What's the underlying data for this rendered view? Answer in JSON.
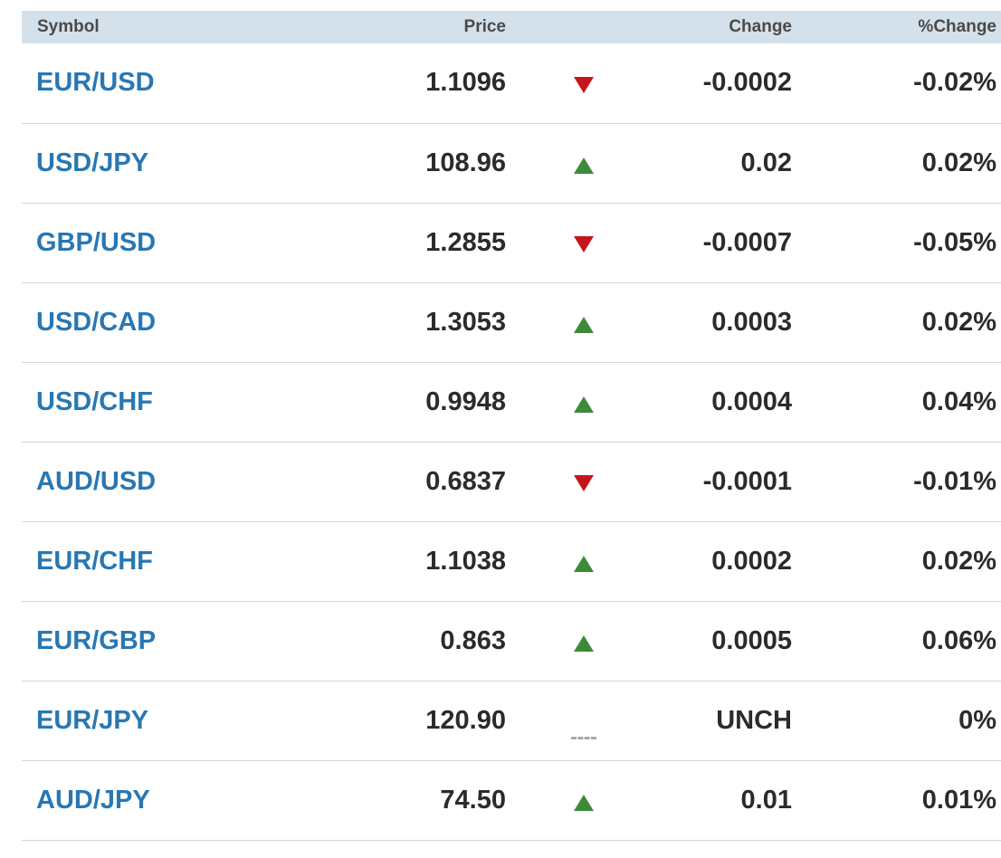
{
  "header": {
    "symbol": "Symbol",
    "price": "Price",
    "change": "Change",
    "pct_change": "%Change"
  },
  "colors": {
    "link": "#2877b4",
    "up": "#3d8a38",
    "down": "#c5151b",
    "unchanged": "#a8a8a8",
    "header_bg": "#d4e1eb"
  },
  "rows": [
    {
      "symbol": "EUR/USD",
      "price": "1.1096",
      "direction": "down",
      "change": "-0.0002",
      "pct": "-0.02%"
    },
    {
      "symbol": "USD/JPY",
      "price": "108.96",
      "direction": "up",
      "change": "0.02",
      "pct": "0.02%"
    },
    {
      "symbol": "GBP/USD",
      "price": "1.2855",
      "direction": "down",
      "change": "-0.0007",
      "pct": "-0.05%"
    },
    {
      "symbol": "USD/CAD",
      "price": "1.3053",
      "direction": "up",
      "change": "0.0003",
      "pct": "0.02%"
    },
    {
      "symbol": "USD/CHF",
      "price": "0.9948",
      "direction": "up",
      "change": "0.0004",
      "pct": "0.04%"
    },
    {
      "symbol": "AUD/USD",
      "price": "0.6837",
      "direction": "down",
      "change": "-0.0001",
      "pct": "-0.01%"
    },
    {
      "symbol": "EUR/CHF",
      "price": "1.1038",
      "direction": "up",
      "change": "0.0002",
      "pct": "0.02%"
    },
    {
      "symbol": "EUR/GBP",
      "price": "0.863",
      "direction": "up",
      "change": "0.0005",
      "pct": "0.06%"
    },
    {
      "symbol": "EUR/JPY",
      "price": "120.90",
      "direction": "unch",
      "change": "UNCH",
      "pct": "0%"
    },
    {
      "symbol": "AUD/JPY",
      "price": "74.50",
      "direction": "up",
      "change": "0.01",
      "pct": "0.01%"
    }
  ]
}
